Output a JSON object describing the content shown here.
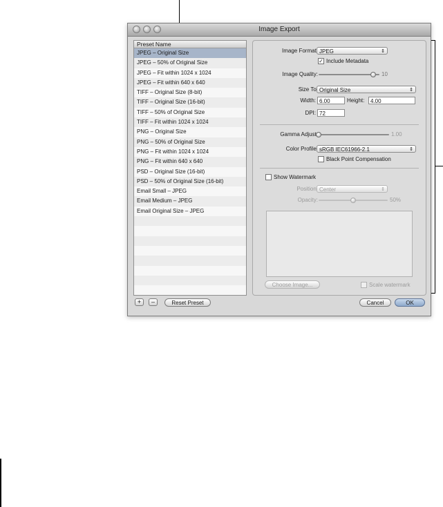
{
  "window": {
    "title": "Image Export"
  },
  "presets": {
    "header": "Preset Name",
    "items": [
      "JPEG – Original Size",
      "JPEG – 50% of Original Size",
      "JPEG – Fit within 1024 x 1024",
      "JPEG – Fit within 640 x 640",
      "TIFF – Original Size (8-bit)",
      "TIFF – Original Size (16-bit)",
      "TIFF – 50% of Original Size",
      "TIFF – Fit within 1024 x 1024",
      "PNG – Original Size",
      "PNG – 50% of Original Size",
      "PNG – Fit within 1024 x 1024",
      "PNG – Fit within 640 x 640",
      "PSD – Original Size (16-bit)",
      "PSD – 50% of Original Size (16-bit)",
      "Email Small – JPEG",
      "Email Medium – JPEG",
      "Email Original Size – JPEG"
    ],
    "selected_index": 0
  },
  "settings": {
    "image_format_label": "Image Format:",
    "image_format_value": "JPEG",
    "include_metadata_label": "Include Metadata",
    "include_metadata_checked": true,
    "image_quality_label": "Image Quality:",
    "image_quality_value": "10",
    "image_quality_level": 0.9,
    "size_to_label": "Size To:",
    "size_to_value": "Original Size",
    "width_label": "Width:",
    "width_value": "6.00",
    "height_label": "Height:",
    "height_value": "4.00",
    "dpi_label": "DPI:",
    "dpi_value": "72",
    "gamma_label": "Gamma Adjust:",
    "gamma_value": "1.00",
    "gamma_level": 0.0,
    "color_profile_label": "Color Profile:",
    "color_profile_value": "sRGB IEC61966-2.1",
    "black_point_label": "Black Point Compensation",
    "black_point_checked": false
  },
  "watermark": {
    "show_label": "Show Watermark",
    "show_checked": false,
    "position_label": "Position:",
    "position_value": "Center",
    "opacity_label": "Opacity:",
    "opacity_value": "50%",
    "opacity_level": 0.5,
    "choose_image_label": "Choose Image...",
    "scale_label": "Scale watermark",
    "scale_checked": false
  },
  "footer": {
    "add_label": "+",
    "remove_label": "–",
    "reset_label": "Reset Preset",
    "cancel_label": "Cancel",
    "ok_label": "OK"
  },
  "icons": {
    "popup_arrows": "⇕",
    "checkmark": "✓",
    "traffic_lights": [
      "close-icon",
      "minimize-icon",
      "zoom-icon"
    ]
  }
}
